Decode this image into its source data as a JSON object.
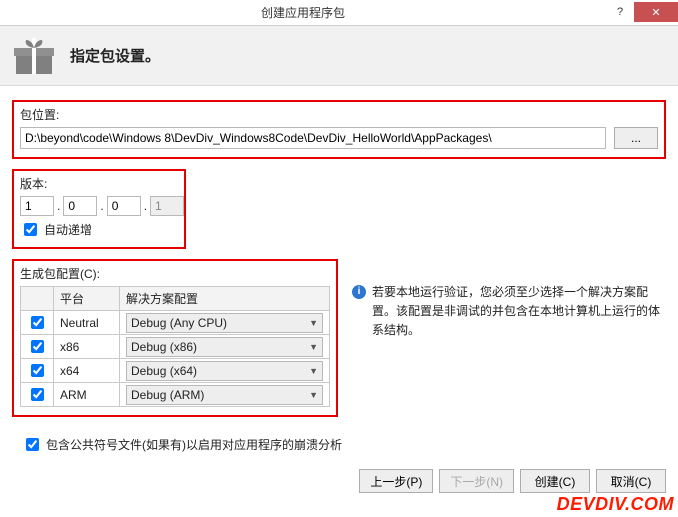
{
  "window": {
    "title": "创建应用程序包"
  },
  "header": {
    "title": "指定包设置。"
  },
  "location": {
    "label": "包位置:",
    "path": "D:\\beyond\\code\\Windows 8\\DevDiv_Windows8Code\\DevDiv_HelloWorld\\AppPackages\\",
    "browse": "..."
  },
  "version": {
    "label": "版本:",
    "parts": [
      "1",
      "0",
      "0",
      "1"
    ],
    "auto_label": "自动递增"
  },
  "config": {
    "label": "生成包配置(C):",
    "col_platform": "平台",
    "col_solution": "解决方案配置",
    "rows": [
      {
        "plat": "Neutral",
        "sol": "Debug (Any CPU)"
      },
      {
        "plat": "x86",
        "sol": "Debug (x86)"
      },
      {
        "plat": "x64",
        "sol": "Debug (x64)"
      },
      {
        "plat": "ARM",
        "sol": "Debug (ARM)"
      }
    ],
    "note": "若要本地运行验证，您必须至少选择一个解决方案配置。该配置是非调试的并包含在本地计算机上运行的体系结构。"
  },
  "symbols": {
    "label": "包含公共符号文件(如果有)以启用对应用程序的崩溃分析"
  },
  "buttons": {
    "prev": "上一步(P)",
    "next": "下一步(N)",
    "create": "创建(C)",
    "cancel": "取消(C)"
  },
  "watermark": "DEVDIV.COM"
}
